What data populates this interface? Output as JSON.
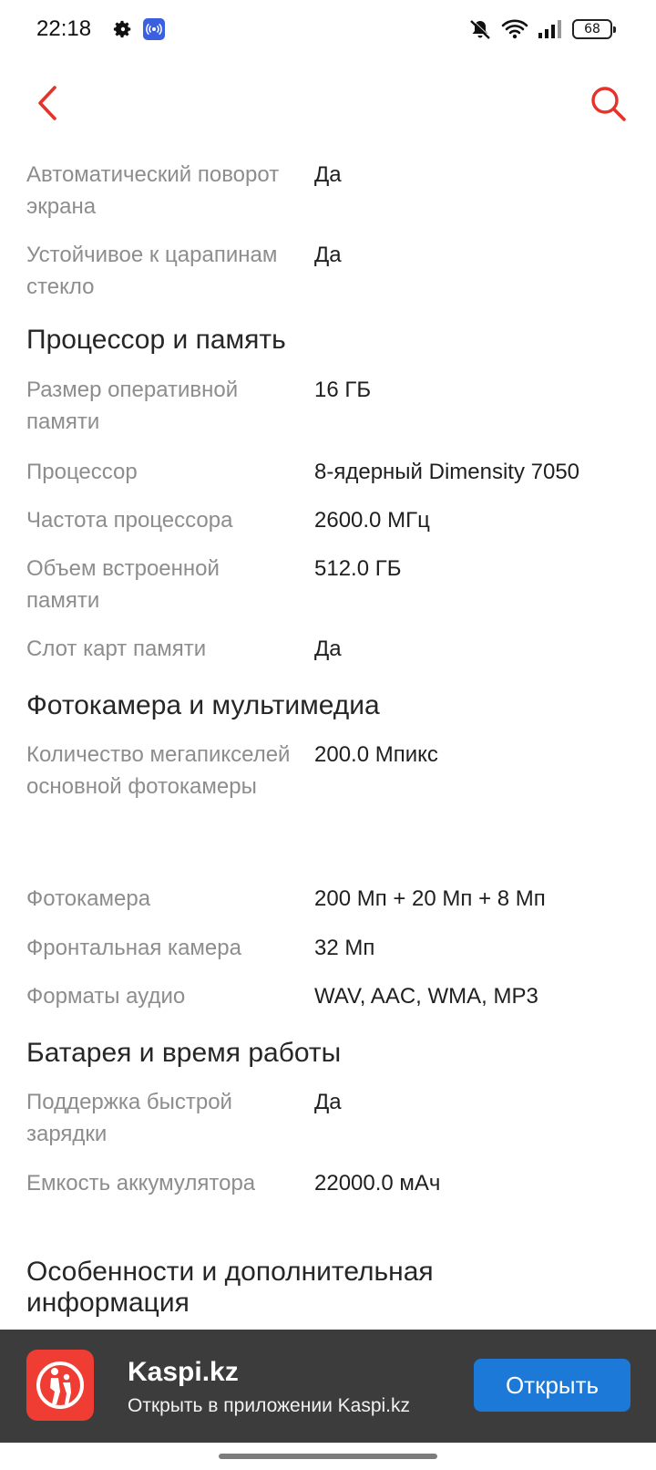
{
  "status_bar": {
    "time": "22:18",
    "icons": [
      "gear-icon",
      "nfc-cast-icon",
      "mute-icon",
      "wifi-icon",
      "signal-icon"
    ],
    "battery": "68"
  },
  "toolbar": {
    "back_icon": "chevron-left-icon",
    "search_icon": "search-icon",
    "accent_color": "#e4332a"
  },
  "specs": {
    "rows_a": [
      {
        "key": "Автоматический поворот экрана",
        "value": "Да"
      },
      {
        "key": "Устойчивое к царапинам стекло",
        "value": "Да"
      }
    ],
    "section_cpu": "Процессор и память",
    "rows_cpu": [
      {
        "key": "Размер оперативной памяти",
        "value": "16 ГБ"
      },
      {
        "key": "Процессор",
        "value": "8-ядерный Dimensity 7050"
      },
      {
        "key": "Частота процессора",
        "value": "2600.0 МГц"
      },
      {
        "key": "Объем встроенной памяти",
        "value": "512.0 ГБ"
      },
      {
        "key": "Слот карт памяти",
        "value": "Да"
      }
    ],
    "section_camera": "Фотокамера и мультимедиа",
    "rows_camera": [
      {
        "key": "Количество мегапикселей основной фотокамеры",
        "value": "200.0 Мпикс"
      },
      {
        "key": "Фотокамера",
        "value": "200 Мп + 20 Мп + 8 Мп"
      },
      {
        "key": "Фронтальная камера",
        "value": "32 Мп"
      },
      {
        "key": "Форматы аудио",
        "value": "WAV, AAC, WMA, MP3"
      }
    ],
    "section_battery": "Батарея и время работы",
    "rows_battery": [
      {
        "key": "Поддержка быстрой зарядки",
        "value": "Да"
      },
      {
        "key": "Емкость аккумулятора",
        "value": "22000.0 мАч"
      }
    ],
    "section_extra": "Особенности и дополнительная информация"
  },
  "banner": {
    "title": "Kaspi.kz",
    "subtitle": "Открыть в приложении Kaspi.kz",
    "open_label": "Открыть",
    "button_color": "#1d79d8",
    "logo_color": "#ef3d33"
  }
}
